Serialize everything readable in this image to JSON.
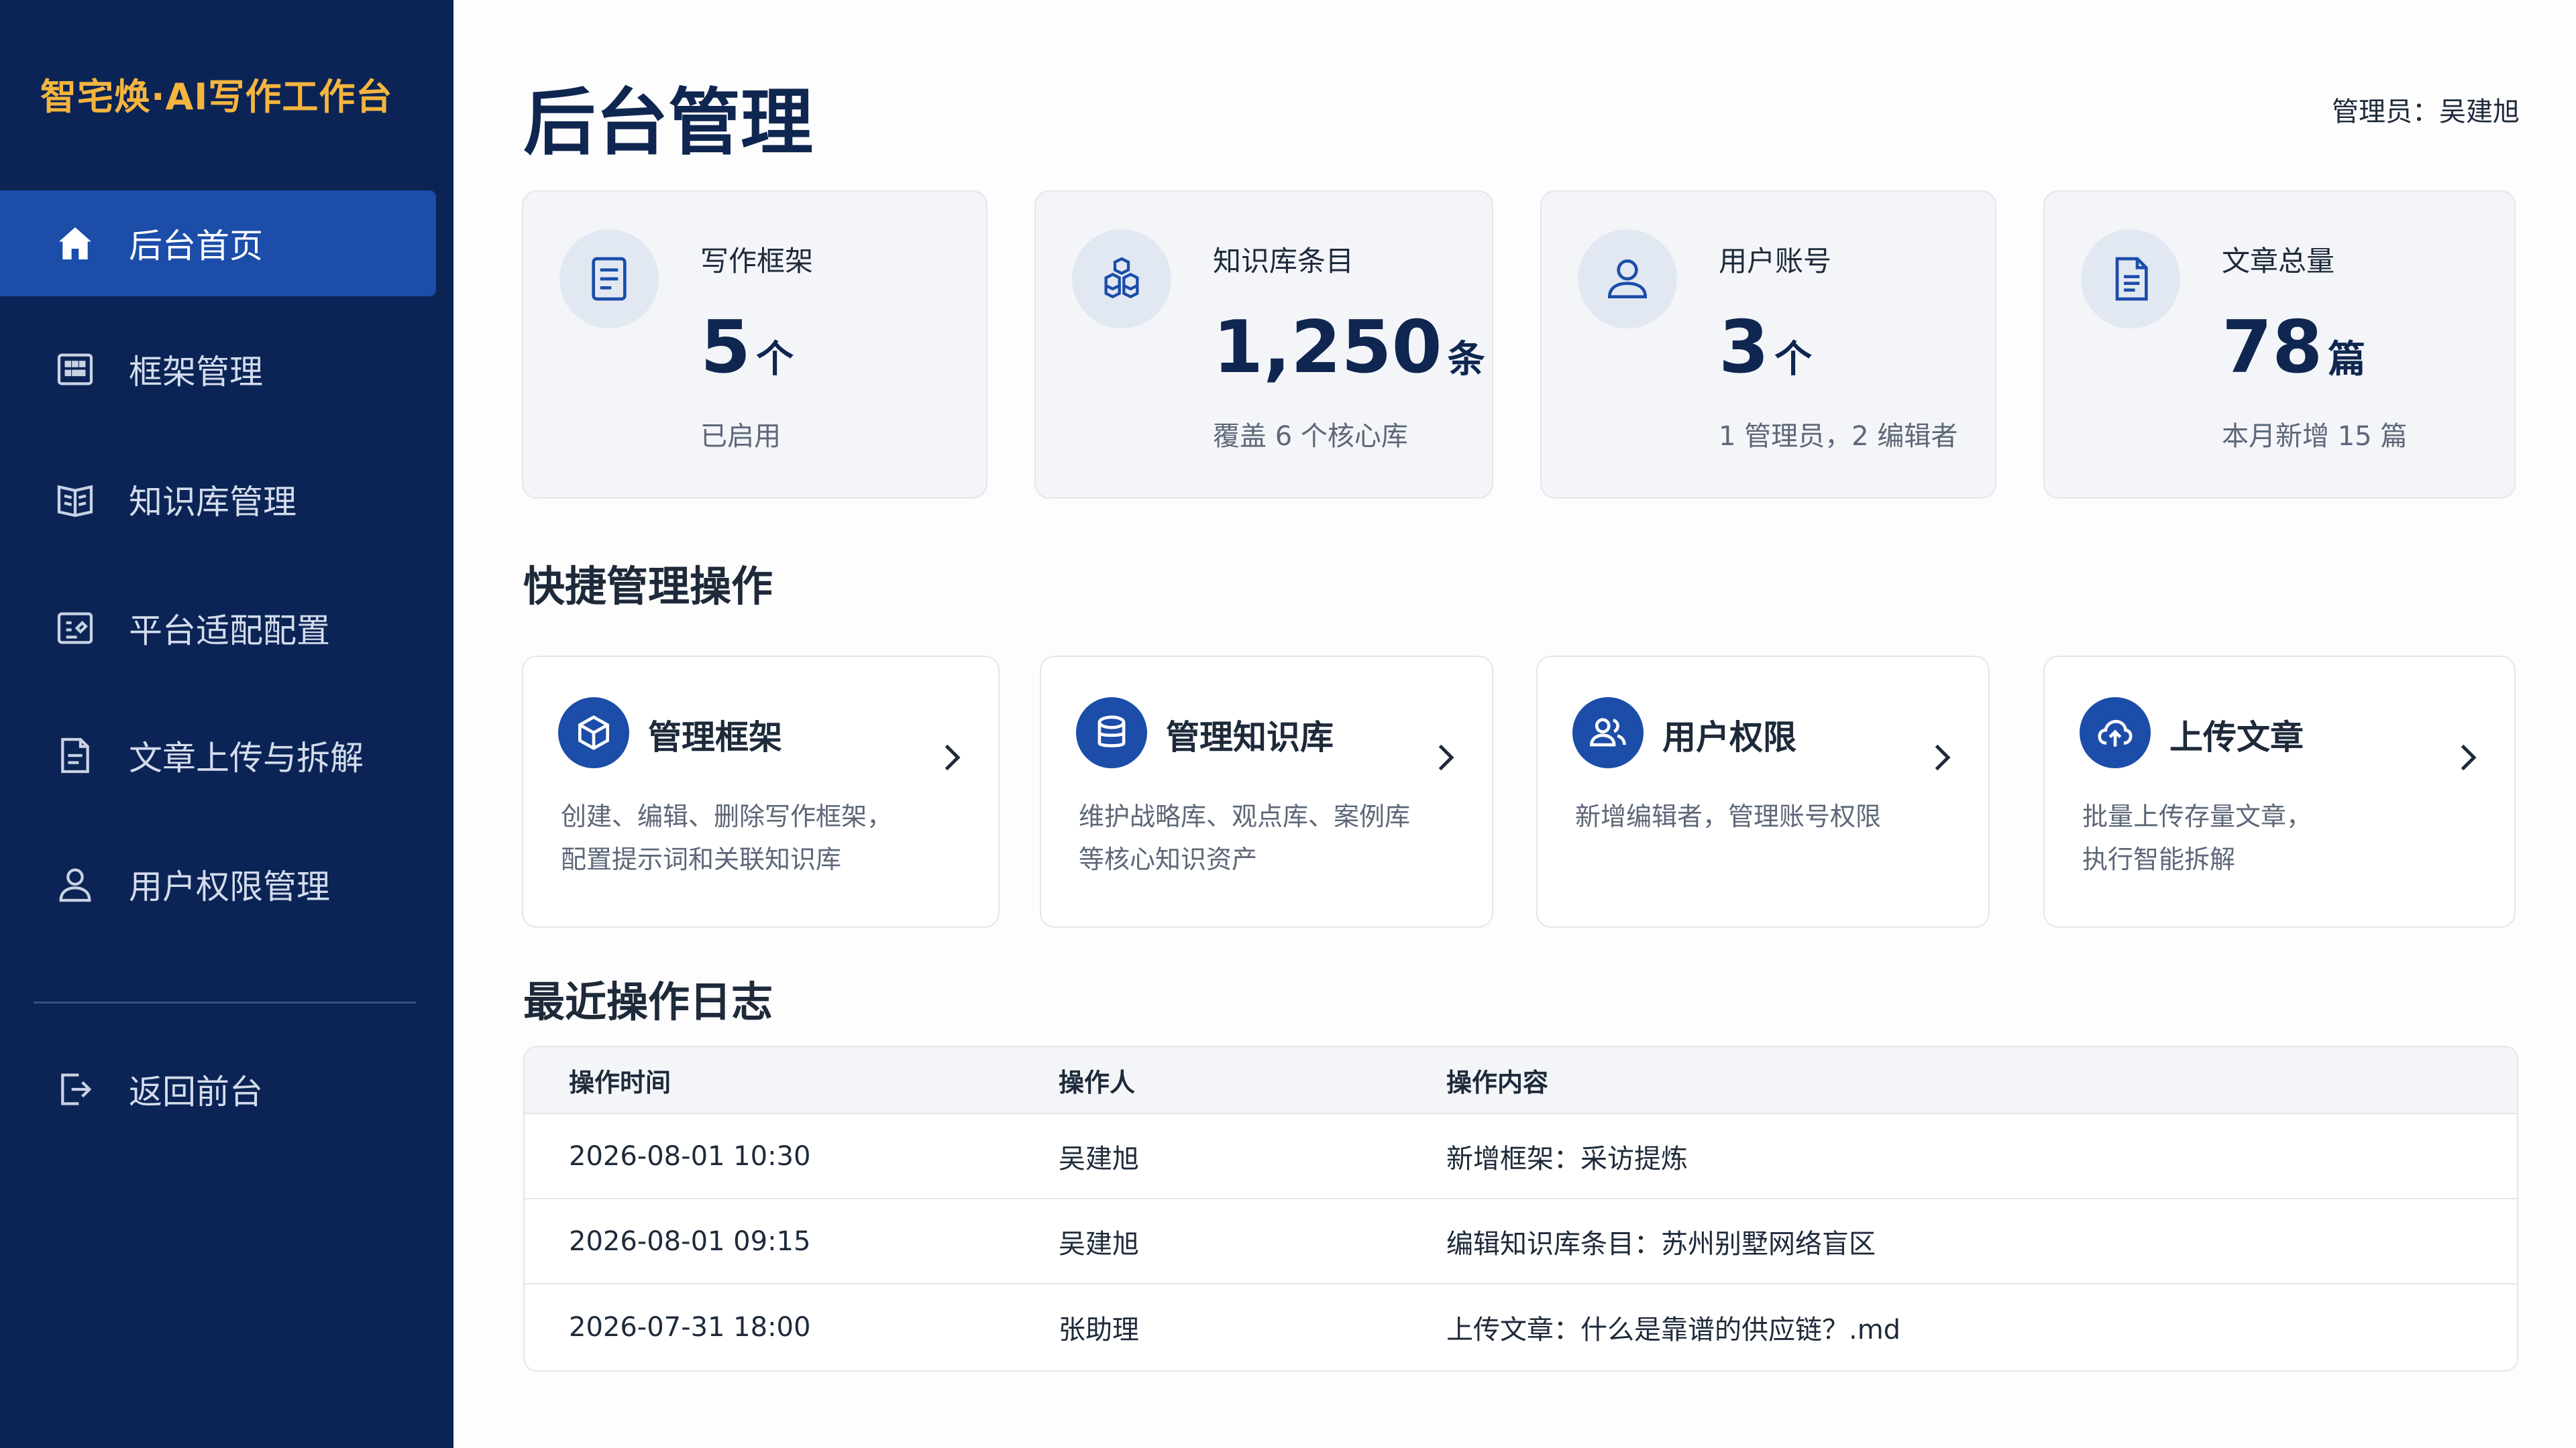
{
  "brand": {
    "title": "智宅焕·AI写作工作台"
  },
  "sidebar": {
    "items": [
      {
        "label": "后台首页",
        "icon": "home-icon",
        "active": true
      },
      {
        "label": "框架管理",
        "icon": "grid-icon",
        "active": false
      },
      {
        "label": "知识库管理",
        "icon": "book-icon",
        "active": false
      },
      {
        "label": "平台适配配置",
        "icon": "config-icon",
        "active": false
      },
      {
        "label": "文章上传与拆解",
        "icon": "document-icon",
        "active": false
      },
      {
        "label": "用户权限管理",
        "icon": "user-icon",
        "active": false
      }
    ],
    "back": {
      "label": "返回前台",
      "icon": "logout-icon"
    }
  },
  "header": {
    "title": "后台管理",
    "admin": "管理员：吴建旭"
  },
  "stats": [
    {
      "label": "写作框架",
      "value": "5",
      "unit": "个",
      "sub": "已启用",
      "icon": "document-list-icon"
    },
    {
      "label": "知识库条目",
      "value": "1,250",
      "unit": "条",
      "sub": "覆盖 6 个核心库",
      "icon": "cubes-icon"
    },
    {
      "label": "用户账号",
      "value": "3",
      "unit": "个",
      "sub": "1 管理员，2 编辑者",
      "icon": "user-icon"
    },
    {
      "label": "文章总量",
      "value": "78",
      "unit": "篇",
      "sub": "本月新增 15 篇",
      "icon": "file-text-icon"
    }
  ],
  "quick": {
    "title": "快捷管理操作",
    "cards": [
      {
        "title": "管理框架",
        "desc1": "创建、编辑、删除写作框架，",
        "desc2": "配置提示词和关联知识库",
        "icon": "box-icon"
      },
      {
        "title": "管理知识库",
        "desc1": "维护战略库、观点库、案例库",
        "desc2": "等核心知识资产",
        "icon": "database-icon"
      },
      {
        "title": "用户权限",
        "desc1": "新增编辑者，管理账号权限",
        "desc2": "",
        "icon": "users-icon"
      },
      {
        "title": "上传文章",
        "desc1": "批量上传存量文章，",
        "desc2": "执行智能拆解",
        "icon": "cloud-upload-icon"
      }
    ]
  },
  "logs": {
    "title": "最近操作日志",
    "columns": [
      "操作时间",
      "操作人",
      "操作内容"
    ],
    "rows": [
      {
        "time": "2026-08-01 10:30",
        "user": "吴建旭",
        "content": "新增框架：采访提炼"
      },
      {
        "time": "2026-08-01 09:15",
        "user": "吴建旭",
        "content": "编辑知识库条目：苏州别墅网络盲区"
      },
      {
        "time": "2026-07-31 18:00",
        "user": "张助理",
        "content": "上传文章：什么是靠谱的供应链？.md"
      }
    ]
  },
  "colors": {
    "sidebar_bg": "#0b2455",
    "active_item": "#1b4da9",
    "brand": "#f4b53f",
    "accent": "#1b4da9"
  }
}
